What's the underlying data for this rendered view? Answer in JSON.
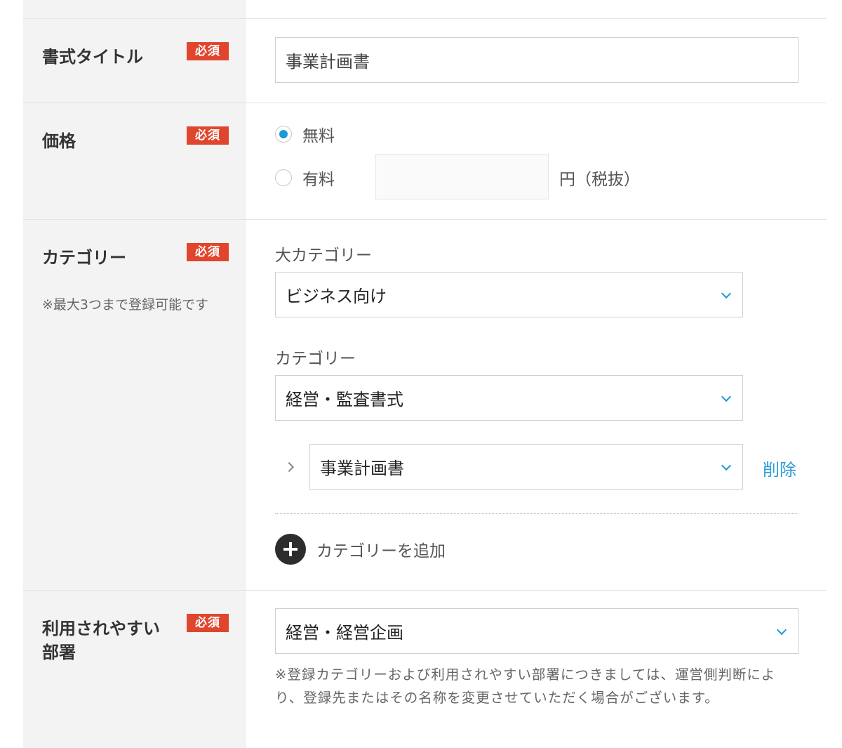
{
  "required_badge": "必須",
  "title_row": {
    "label": "書式タイトル",
    "value": "事業計画書"
  },
  "price_row": {
    "label": "価格",
    "free_label": "無料",
    "paid_label": "有料",
    "price_value": "",
    "unit_label": "円（税抜）",
    "selected": "free"
  },
  "category_row": {
    "label": "カテゴリー",
    "note": "※最大3つまで登録可能です",
    "major_label": "大カテゴリー",
    "major_value": "ビジネス向け",
    "category_label": "カテゴリー",
    "category_value": "経営・監査書式",
    "sub_value": "事業計画書",
    "delete_label": "削除",
    "add_label": "カテゴリーを追加"
  },
  "department_row": {
    "label_line1": "利用されやすい",
    "label_line2": "部署",
    "value": "経営・経営企画",
    "note": "※登録カテゴリーおよび利用されやすい部署につきましては、運営側判断により、登録先またはその名称を変更させていただく場合がございます。"
  },
  "colors": {
    "accent": "#1a9ad6",
    "required": "#e0462d",
    "label_bg": "#f3f3f3"
  }
}
